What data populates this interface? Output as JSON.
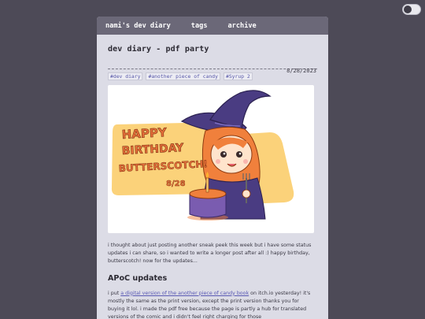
{
  "toggle": {
    "state": "off"
  },
  "nav": {
    "items": [
      {
        "label": "nami's dev diary"
      },
      {
        "label": "tags"
      },
      {
        "label": "archive"
      }
    ]
  },
  "post": {
    "title": "dev diary - pdf party",
    "date": "8/28/2023",
    "tags": [
      "#dev diary",
      "#another piece of candy",
      "#Syrup 2"
    ],
    "illustration": {
      "text_lines": [
        "HAPPY",
        "BIRTHDAY",
        "BUTTERSCOTCH!"
      ],
      "date_text": "8/28"
    },
    "intro": "i thought about just posting another sneak peek this week but i have some status updates i can share, so i wanted to write a longer post after all :) happy birthday, butterscotch! now for the updates...",
    "section_heading": "APoC updates",
    "section_text_before": "i put ",
    "section_link": "a digital version of the another piece of candy book",
    "section_text_after": " on itch.io yesterday! it's mostly the same as the print version, except the print version thanks you for buying it lol. i made the pdf free because the page is partly a hub for translated versions of the comic and i didn't feel right charging for those"
  },
  "colors": {
    "background": "#4d4a57",
    "card": "#dcdce6",
    "nav": "#6b6878",
    "link": "#5a5ab4",
    "illustration_yellow": "#fbd27a",
    "illustration_purple": "#4a3c82",
    "illustration_orange": "#f0803c"
  }
}
